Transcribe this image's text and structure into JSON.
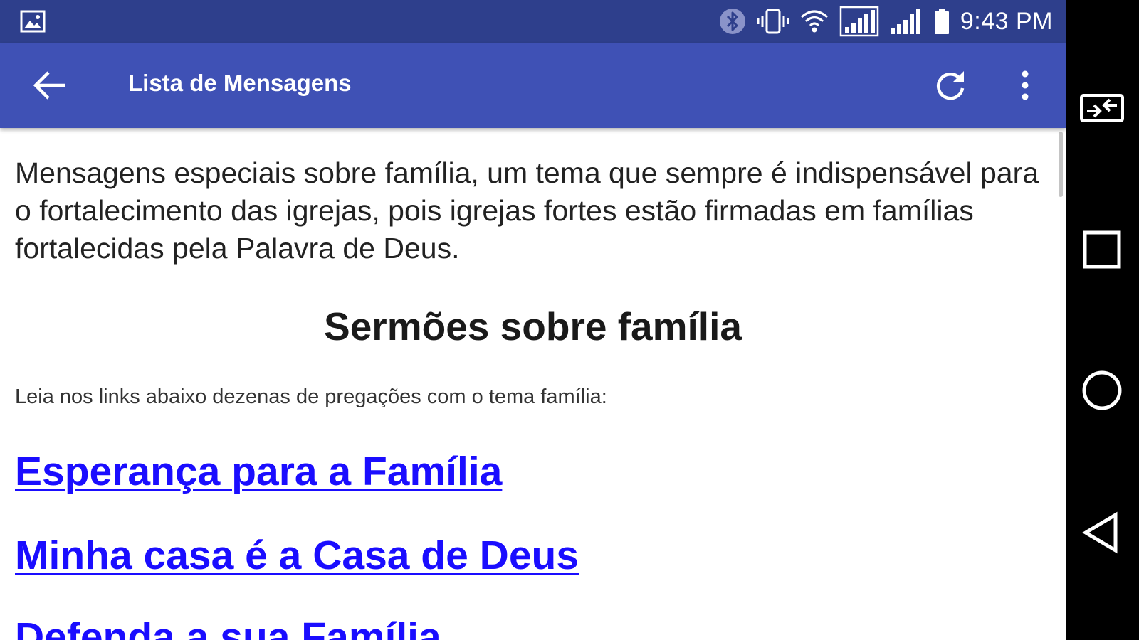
{
  "status_bar": {
    "time": "9:43 PM",
    "icons": [
      "image-notification-icon",
      "bluetooth-icon",
      "vibrate-icon",
      "wifi-icon",
      "signal-icon",
      "signal-icon",
      "battery-icon"
    ],
    "background": "#2e3f8c"
  },
  "app_bar": {
    "title": "Lista de Mensagens",
    "back_icon": "back-arrow-icon",
    "refresh_icon": "refresh-icon",
    "more_icon": "more-vert-icon",
    "background": "#3f51b5"
  },
  "content": {
    "intro": "Mensagens especiais sobre família, um tema que sempre é indispensável para o fortalecimento das igrejas, pois igrejas fortes estão firmadas em famílias fortalecidas pela Palavra de Deus.",
    "heading": "Sermões sobre família",
    "subtitle": "Leia nos links abaixo dezenas de pregações com o tema família:",
    "links": [
      {
        "label": "Esperança para a Família"
      },
      {
        "label": "Minha casa é a Casa de Deus"
      },
      {
        "label": "Defenda a sua Família"
      }
    ],
    "link_color": "#1a0dff"
  },
  "nav_bar": {
    "icons": [
      "screen-rotate-icon",
      "recent-apps-icon",
      "home-icon",
      "nav-back-icon"
    ]
  }
}
